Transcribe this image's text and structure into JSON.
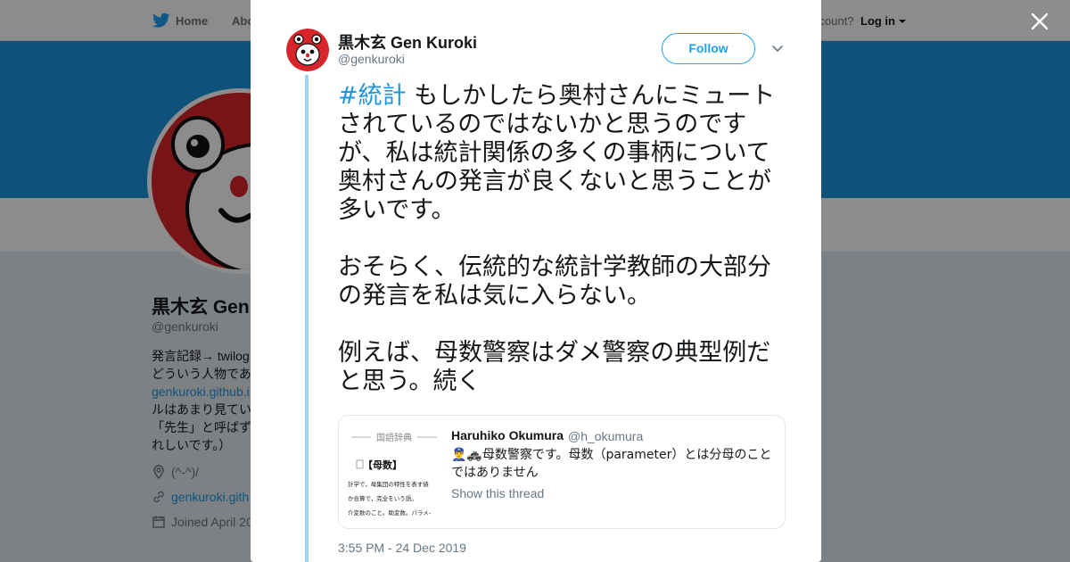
{
  "nav": {
    "home_label": "Home",
    "about_label": "Abo",
    "account_text": "ccount?",
    "login_label": "Log in"
  },
  "profile": {
    "name": "黒木玄 Gen",
    "handle": "@genkuroki",
    "bio_lines": [
      "発言記録→ twilog",
      "どういう人物であ",
      "genkuroki.github.i",
      "ルはあまり見てい",
      "「先生」と呼ばず",
      "れしいです。）"
    ],
    "location": "(^-^)/",
    "website": "genkuroki.gith",
    "joined": "Joined April 20",
    "brand_color": "#1b95e0"
  },
  "modal": {
    "author_name": "黒木玄 Gen Kuroki",
    "author_handle": "@genkuroki",
    "follow_label": "Follow",
    "hashtag": "#統計",
    "paragraphs": [
      "もしかしたら奥村さんにミュートされているのではないかと思うのですが、私は統計関係の多くの事柄について奥村さんの発言が良くないと思うことが多いです。",
      "おそらく、伝統的な統計学教師の大部分の発言を私は気に入らない。",
      "例えば、母数警察はダメ警察の典型例だと思う。続く"
    ],
    "quote": {
      "name": "Haruhiko Okumura",
      "handle": "@h_okumura",
      "text": "👮‍♂️🚓母数警察です。母数（parameter）とは分母のことではありません",
      "show_thread": "Show this thread",
      "thumb_title": "国語辞典",
      "thumb_word": "【母数】",
      "thumb_lines": [
        "計学で，母集団の特性を表す値",
        "か合算で，完全をいう語。",
        "介変数のこと。助変数。パラメ-"
      ]
    },
    "timestamp": "3:55 PM - 24 Dec 2019"
  },
  "icons": {
    "nav": "twitter-bird-icon",
    "close": "close-icon",
    "more": "chevron-down-icon",
    "location": "location-pin-icon",
    "link": "link-icon",
    "calendar": "calendar-icon"
  }
}
